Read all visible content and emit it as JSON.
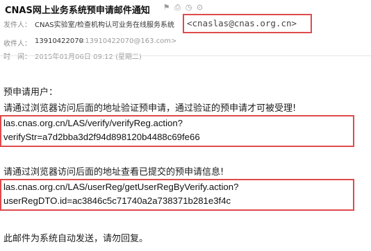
{
  "email": {
    "subject": "CNAS网上业务系统预申请邮件通知",
    "header_icons": [
      "flag-icon",
      "print-icon",
      "clock-icon",
      "more-icon"
    ],
    "sender": {
      "label": "发件人：",
      "name": "CNAS实验室/检查机构认可业务在线服务系统",
      "address_highlight": "<cnaslas@cnas.org.cn>"
    },
    "recipient": {
      "label": "收件人：",
      "name": "13910422070",
      "address": "<13910422070@163.com>"
    },
    "time": {
      "label": "时　间：",
      "value": "2015年01月06日 09:12 (星期二)"
    },
    "body": {
      "greeting": "预申请用户：",
      "instruction_verify": "请通过浏览器访问后面的地址验证预申请，通过验证的预申请才可被受理!",
      "verify_url_line1": "las.cnas.org.cn/LAS/verify/verifyReg.action?",
      "verify_url_line2": "verifyStr=a7d2bba3d2f94d898120b4488c69fe66",
      "instruction_view": "请通过浏览器访问后面的地址查看已提交的预申请信息!",
      "view_url_line1": "las.cnas.org.cn/LAS/userReg/getUserRegByVerify.action?",
      "view_url_line2": "userRegDTO.id=ac3846c5c71740a2a738371b281e3f4c",
      "footer": "此邮件为系统自动发送，请勿回复。"
    },
    "colors": {
      "highlight_border": "#e04a4a",
      "label_gray": "#8a8a8a"
    }
  }
}
